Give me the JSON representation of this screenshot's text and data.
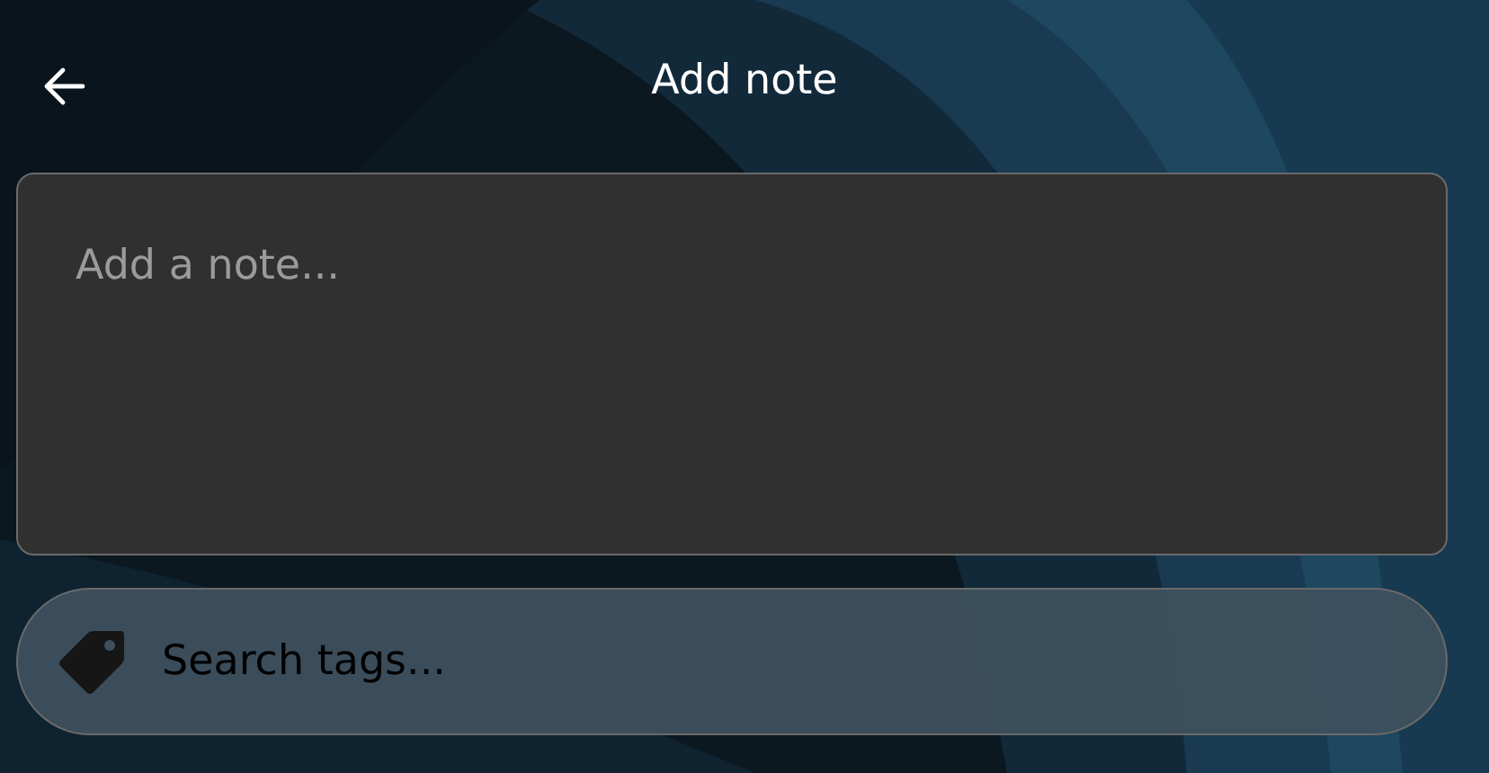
{
  "header": {
    "title": "Add note"
  },
  "note": {
    "placeholder": "Add a note..."
  },
  "tags": {
    "placeholder": "Search tags..."
  }
}
